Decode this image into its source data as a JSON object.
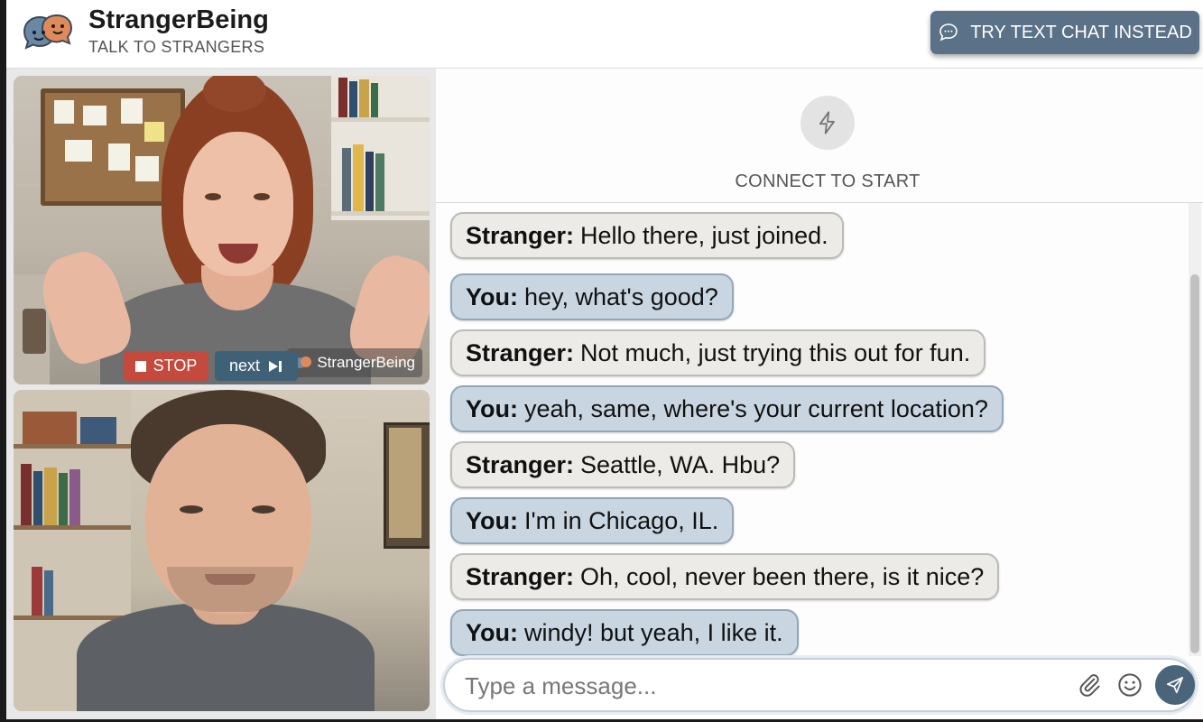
{
  "header": {
    "brand_name": "StrangerBeing",
    "tagline": "TALK TO STRANGERS",
    "text_chat_button": "TRY TEXT CHAT INSTEAD"
  },
  "video": {
    "watermark": "StrangerBeing",
    "stop_label": "STOP",
    "next_label": "next"
  },
  "chat": {
    "connect_label": "CONNECT TO START",
    "messages": [
      {
        "sender": "Stranger:",
        "text": "Hello there, just joined."
      },
      {
        "sender": "You:",
        "text": "hey, what's good?"
      },
      {
        "sender": "Stranger:",
        "text": "Not much, just trying this out for fun."
      },
      {
        "sender": "You:",
        "text": "yeah, same, where's your current location?"
      },
      {
        "sender": "Stranger:",
        "text": "Seattle, WA. Hbu?"
      },
      {
        "sender": "You:",
        "text": "I'm in Chicago, IL."
      },
      {
        "sender": "Stranger:",
        "text": "Oh, cool, never been there, is it nice?"
      },
      {
        "sender": "You:",
        "text": "windy! but yeah, I like it."
      }
    ],
    "input_placeholder": "Type a message...",
    "input_value": ""
  },
  "colors": {
    "accent": "#5a7187",
    "stop": "#c44a3e",
    "next": "#3f6178",
    "you_bubble": "#c9d6e2",
    "stranger_bubble": "#ecebe7"
  },
  "icons": {
    "logo": "speech-bubbles-logo",
    "text_chat": "chat-bubble-icon",
    "connect": "lightning-icon",
    "attach": "paperclip-icon",
    "emoji": "smiley-icon",
    "send": "paper-plane-icon"
  }
}
